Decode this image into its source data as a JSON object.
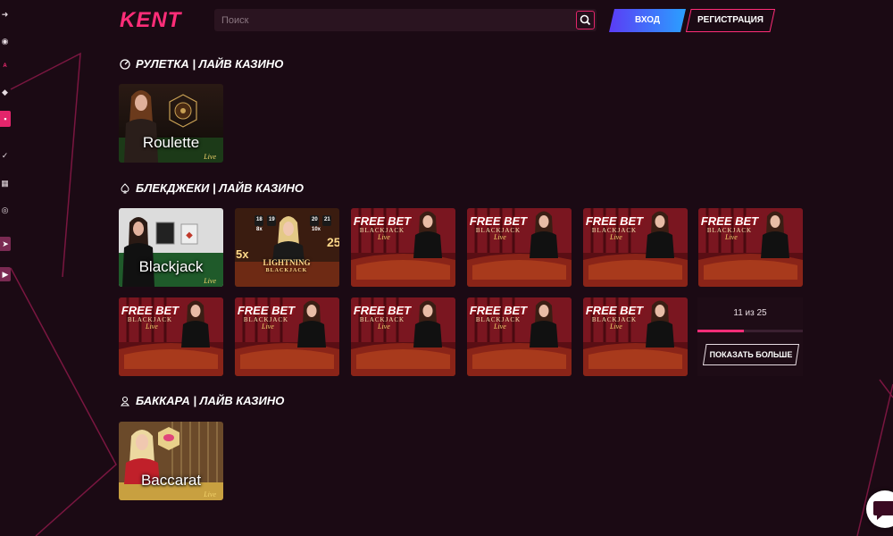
{
  "header": {
    "logo": "KENT",
    "search_placeholder": "Поиск",
    "search_value": "",
    "login_label": "ВХОД",
    "register_label": "РЕГИСТРАЦИЯ"
  },
  "sidebar": {
    "badge_text": "A",
    "icons": [
      "login-arrow-icon",
      "promo-icon",
      "promo-badge-icon",
      "location-icon",
      "gift-icon",
      "check-icon",
      "calendar-icon",
      "globe-icon",
      "telegram-icon",
      "youtube-icon"
    ]
  },
  "sections": [
    {
      "title": "РУЛЕТКА | ЛАЙВ КАЗИНО",
      "icon": "roulette-icon",
      "games": [
        {
          "label": "Roulette",
          "live": "Live"
        }
      ]
    },
    {
      "title": "БЛЕКДЖЕКИ | ЛАЙВ КАЗИНО",
      "icon": "spade-icon",
      "games": [
        {
          "label": "Blackjack",
          "live": "Live"
        },
        {
          "label": "LIGHTNING",
          "sub": "BLACKJACK",
          "mult_a": "5x",
          "mult_b": "25",
          "n1": "18",
          "n2": "19",
          "n3": "20",
          "n4": "21",
          "m1": "8x",
          "m2": "10x"
        },
        {
          "label": "FREE BET",
          "sub": "BLACKJACK",
          "live": "Live"
        },
        {
          "label": "FREE BET",
          "sub": "BLACKJACK",
          "live": "Live"
        },
        {
          "label": "FREE BET",
          "sub": "BLACKJACK",
          "live": "Live"
        },
        {
          "label": "FREE BET",
          "sub": "BLACKJACK",
          "live": "Live"
        },
        {
          "label": "FREE BET",
          "sub": "BLACKJACK",
          "live": "Live"
        },
        {
          "label": "FREE BET",
          "sub": "BLACKJACK",
          "live": "Live"
        },
        {
          "label": "FREE BET",
          "sub": "BLACKJACK",
          "live": "Live"
        },
        {
          "label": "FREE BET",
          "sub": "BLACKJACK",
          "live": "Live"
        },
        {
          "label": "FREE BET",
          "sub": "BLACKJACK",
          "live": "Live"
        }
      ],
      "counter": "11 из 25",
      "progress": 0.44,
      "show_more_label": "ПОКАЗАТЬ БОЛЬШЕ"
    },
    {
      "title": "БАККАРА | ЛАЙВ КАЗИНО",
      "icon": "baccarat-icon",
      "games": [
        {
          "label": "Baccarat",
          "live": "Live"
        }
      ]
    }
  ],
  "colors": {
    "background": "#1b0a14",
    "accent": "#ff2d78",
    "login_gradient_start": "#5b3cf5",
    "login_gradient_end": "#2aa0ff"
  },
  "chat_icon": "chat-bubble-icon"
}
